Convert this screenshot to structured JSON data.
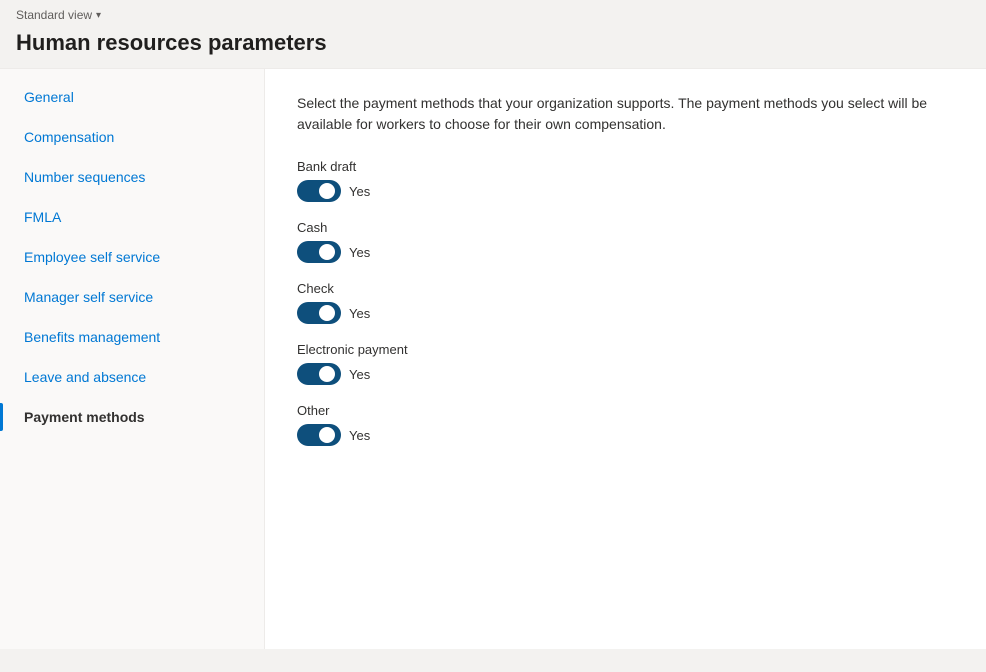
{
  "view": {
    "label": "Standard view",
    "chevron": "▾"
  },
  "page": {
    "title": "Human resources parameters"
  },
  "description": "Select the payment methods that your organization supports. The payment methods you select will be available for workers to choose for their own compensation.",
  "sidebar": {
    "items": [
      {
        "id": "general",
        "label": "General",
        "active": false
      },
      {
        "id": "compensation",
        "label": "Compensation",
        "active": false
      },
      {
        "id": "number-sequences",
        "label": "Number sequences",
        "active": false
      },
      {
        "id": "fmla",
        "label": "FMLA",
        "active": false
      },
      {
        "id": "employee-self-service",
        "label": "Employee self service",
        "active": false
      },
      {
        "id": "manager-self-service",
        "label": "Manager self service",
        "active": false
      },
      {
        "id": "benefits-management",
        "label": "Benefits management",
        "active": false
      },
      {
        "id": "leave-and-absence",
        "label": "Leave and absence",
        "active": false
      },
      {
        "id": "payment-methods",
        "label": "Payment methods",
        "active": true
      }
    ]
  },
  "payment_methods": [
    {
      "id": "bank-draft",
      "label": "Bank draft",
      "enabled": true,
      "yes_label": "Yes"
    },
    {
      "id": "cash",
      "label": "Cash",
      "enabled": true,
      "yes_label": "Yes"
    },
    {
      "id": "check",
      "label": "Check",
      "enabled": true,
      "yes_label": "Yes"
    },
    {
      "id": "electronic-payment",
      "label": "Electronic payment",
      "enabled": true,
      "yes_label": "Yes"
    },
    {
      "id": "other",
      "label": "Other",
      "enabled": true,
      "yes_label": "Yes"
    }
  ]
}
